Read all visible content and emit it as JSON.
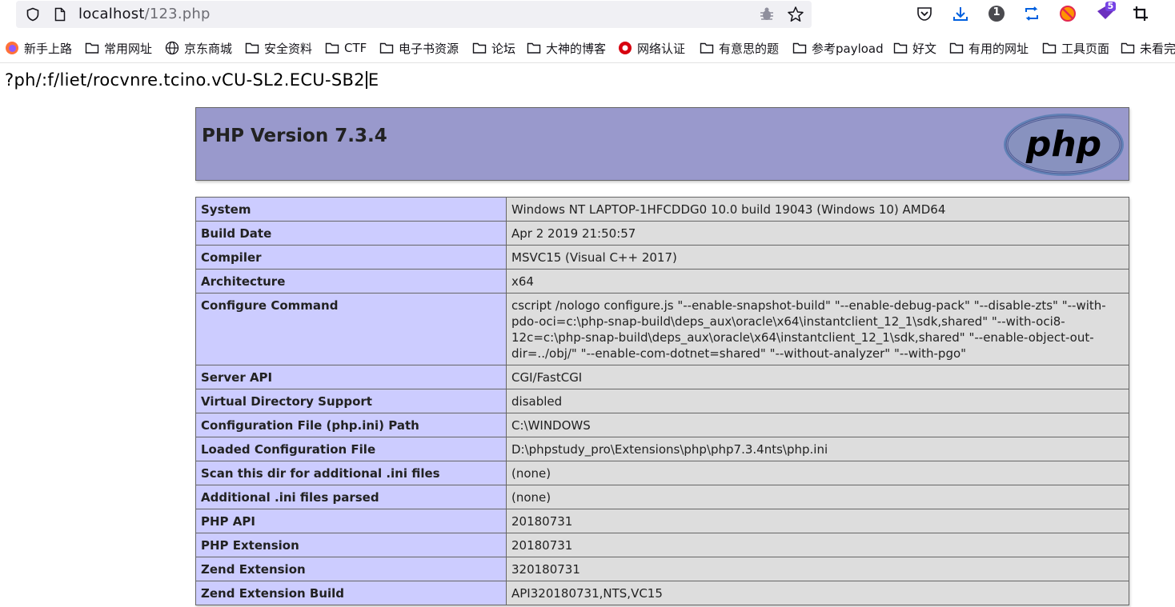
{
  "browser": {
    "url_host": "localhost",
    "url_path": "/123.php",
    "toolbar_badges": {
      "counter": "1",
      "extension": "5"
    }
  },
  "bookmarks": [
    {
      "label": "新手上路",
      "icon": "firefox-icon"
    },
    {
      "label": "常用网址",
      "icon": "folder-icon"
    },
    {
      "label": "京东商城",
      "icon": "globe-icon"
    },
    {
      "label": "安全资料",
      "icon": "folder-icon"
    },
    {
      "label": "CTF",
      "icon": "folder-icon"
    },
    {
      "label": "电子书资源",
      "icon": "folder-icon"
    },
    {
      "label": "论坛",
      "icon": "folder-icon"
    },
    {
      "label": "大神的博客",
      "icon": "folder-icon"
    },
    {
      "label": "网络认证",
      "icon": "network-auth-icon"
    },
    {
      "label": "有意思的题",
      "icon": "folder-icon"
    },
    {
      "label": "参考payload",
      "icon": "folder-icon"
    },
    {
      "label": "好文",
      "icon": "folder-icon"
    },
    {
      "label": "有用的网址",
      "icon": "folder-icon"
    },
    {
      "label": "工具页面",
      "icon": "folder-icon"
    },
    {
      "label": "未看完",
      "icon": "folder-icon"
    }
  ],
  "page": {
    "typed_before": "?ph/:f/liet/rocvnre.tcino.vCU-SL2.ECU-SB2",
    "typed_after": "E",
    "php_version": "PHP Version 7.3.4",
    "logo_text": "php"
  },
  "info_rows": [
    {
      "key": "System",
      "value": "Windows NT LAPTOP-1HFCDDG0 10.0 build 19043 (Windows 10) AMD64"
    },
    {
      "key": "Build Date",
      "value": "Apr 2 2019 21:50:57"
    },
    {
      "key": "Compiler",
      "value": "MSVC15 (Visual C++ 2017)"
    },
    {
      "key": "Architecture",
      "value": "x64"
    },
    {
      "key": "Configure Command",
      "value": "cscript /nologo configure.js \"--enable-snapshot-build\" \"--enable-debug-pack\" \"--disable-zts\" \"--with-pdo-oci=c:\\php-snap-build\\deps_aux\\oracle\\x64\\instantclient_12_1\\sdk,shared\" \"--with-oci8-12c=c:\\php-snap-build\\deps_aux\\oracle\\x64\\instantclient_12_1\\sdk,shared\" \"--enable-object-out-dir=../obj/\" \"--enable-com-dotnet=shared\" \"--without-analyzer\" \"--with-pgo\""
    },
    {
      "key": "Server API",
      "value": "CGI/FastCGI"
    },
    {
      "key": "Virtual Directory Support",
      "value": "disabled"
    },
    {
      "key": "Configuration File (php.ini) Path",
      "value": "C:\\WINDOWS"
    },
    {
      "key": "Loaded Configuration File",
      "value": "D:\\phpstudy_pro\\Extensions\\php\\php7.3.4nts\\php.ini"
    },
    {
      "key": "Scan this dir for additional .ini files",
      "value": "(none)"
    },
    {
      "key": "Additional .ini files parsed",
      "value": "(none)"
    },
    {
      "key": "PHP API",
      "value": "20180731"
    },
    {
      "key": "PHP Extension",
      "value": "20180731"
    },
    {
      "key": "Zend Extension",
      "value": "320180731"
    },
    {
      "key": "Zend Extension Build",
      "value": "API320180731,NTS,VC15"
    }
  ],
  "colors": {
    "header_bg": "#9999cc",
    "key_bg": "#ccccff",
    "value_bg": "#dddddd",
    "toolbar_accent": "#0060df"
  }
}
